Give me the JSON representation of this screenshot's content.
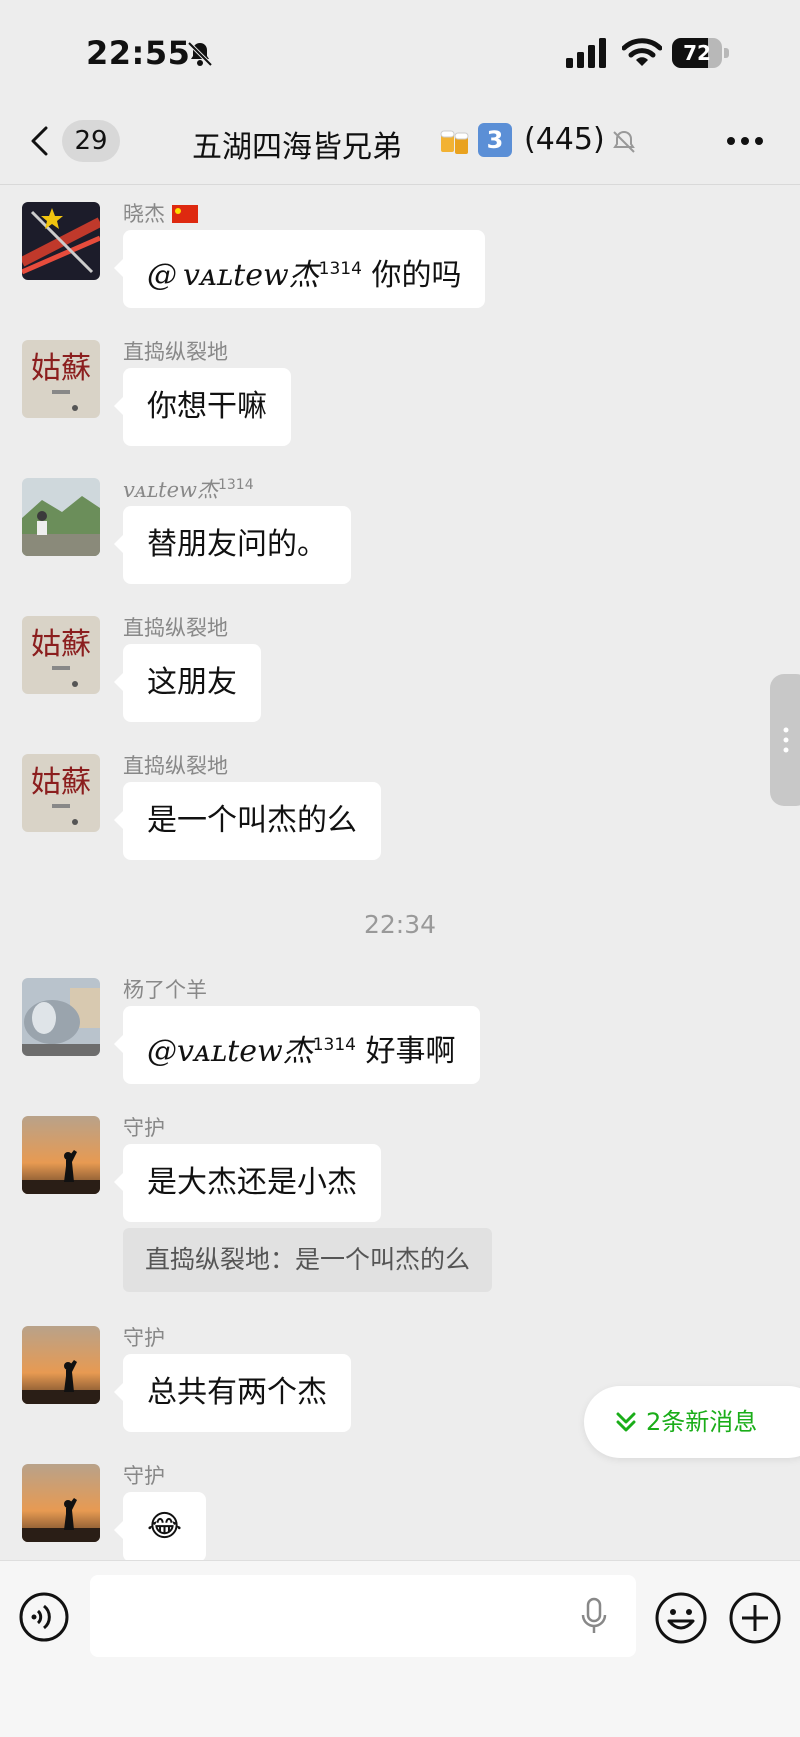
{
  "status_bar": {
    "time": "22:55",
    "battery": "72",
    "battery_level": 0.72
  },
  "nav": {
    "unread_count": "29",
    "title": "五湖四海皆兄弟",
    "title_emoji": "beer-mugs-emoji",
    "badge": "3",
    "member_count": "(445)"
  },
  "messages": [
    {
      "sender": "晓杰",
      "flag": "china-flag-icon",
      "avatar": "fireworks-avatar",
      "text": "@ vᴀʟtew杰",
      "mention_sup": "1314",
      "tail": " 你的吗"
    },
    {
      "sender": "直捣纵裂地",
      "avatar": "gusu-calligraphy-avatar",
      "text": "你想干嘛"
    },
    {
      "sender": "vᴀʟtew杰",
      "sender_sup": "1314",
      "avatar": "mountain-person-avatar",
      "text": "替朋友问的。"
    },
    {
      "sender": "直捣纵裂地",
      "avatar": "gusu-calligraphy-avatar",
      "text": "这朋友"
    },
    {
      "sender": "直捣纵裂地",
      "avatar": "gusu-calligraphy-avatar",
      "text": "是一个叫杰的么"
    },
    {
      "timestamp": "22:34"
    },
    {
      "sender": "杨了个羊",
      "avatar": "silver-tank-avatar",
      "text": "@vᴀʟtew杰",
      "mention_sup": "1314",
      "tail": " 好事啊"
    },
    {
      "sender": "守护",
      "avatar": "sunset-silhouette-avatar",
      "text": "是大杰还是小杰",
      "quote": "直捣纵裂地：是一个叫杰的么"
    },
    {
      "sender": "守护",
      "avatar": "sunset-silhouette-avatar",
      "text": "总共有两个杰"
    },
    {
      "sender": "守护",
      "avatar": "sunset-silhouette-avatar",
      "emoji": "😂"
    }
  ],
  "new_messages_label": "2条新消息",
  "input": {
    "placeholder": ""
  },
  "colors": {
    "background": "#ededed",
    "bubble": "#ffffff",
    "accent_green": "#1aad19"
  },
  "gusu_text": "姑蘇"
}
